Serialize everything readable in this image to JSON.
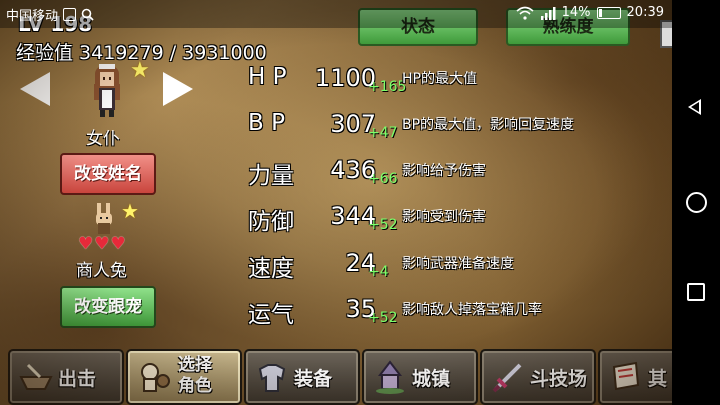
{
  "status_bar": {
    "carrier": "中国移动",
    "battery": "14%",
    "time": "20:39",
    "icons": [
      "gallery-icon",
      "search-icon",
      "wifi-icon",
      "signal-icon",
      "battery-icon"
    ]
  },
  "header": {
    "level_text": "LV 198",
    "exp_text": "经验值 3419279 / 3931000",
    "top_buttons": [
      "状态",
      "熟练度"
    ]
  },
  "character": {
    "name": "女仆",
    "rename_button": "改变姓名",
    "pet_name": "商人兔",
    "pet_hearts": "♥♥♥",
    "change_pet_button": "改变跟宠"
  },
  "stats": [
    {
      "name": "H P",
      "value": "1100",
      "bonus": "+165",
      "desc": "HP的最大值"
    },
    {
      "name": "B P",
      "value": "307",
      "bonus": "+47",
      "desc": "BP的最大值，影响回复速度"
    },
    {
      "name": "力量",
      "value": "436",
      "bonus": "+66",
      "desc": "影响给予伤害"
    },
    {
      "name": "防御",
      "value": "344",
      "bonus": "+52",
      "desc": "影响受到伤害"
    },
    {
      "name": "速度",
      "value": "24",
      "bonus": "+4",
      "desc": "影响武器准备速度"
    },
    {
      "name": "运气",
      "value": "35",
      "bonus": "+52",
      "desc": "影响敌人掉落宝箱几率"
    }
  ],
  "tabs": [
    {
      "label": "出击",
      "icon": "boat-icon"
    },
    {
      "label_line1": "选择",
      "label_line2": "角色",
      "icon": "character-icon"
    },
    {
      "label": "装备",
      "icon": "armor-icon"
    },
    {
      "label": "城镇",
      "icon": "town-icon"
    },
    {
      "label": "斗技场",
      "icon": "sword-icon"
    },
    {
      "label": "其",
      "icon": "scroll-icon"
    }
  ],
  "colors": {
    "bonus_green": "#7cff6a",
    "button_red": "#c9453d",
    "button_green": "#3f9a3a",
    "heart_red": "#e62a3a"
  }
}
